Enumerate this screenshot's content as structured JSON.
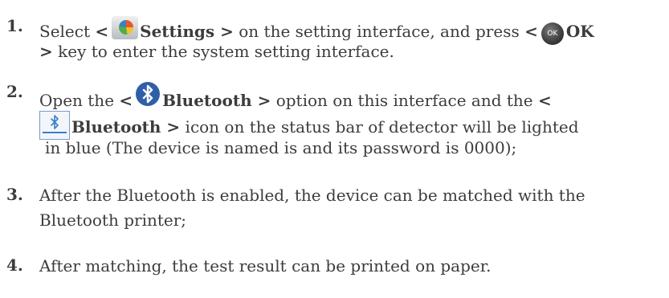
{
  "steps": [
    {
      "number": "1.",
      "line1": {
        "t1": "Select ",
        "lt": "<",
        "settings": "Settings >",
        "t2": " on the setting interface, and press ",
        "lt2": "<",
        "ok_glyph": "OK",
        "ok": "OK"
      },
      "line2": {
        "gt": ">",
        "t": " key to enter the system setting interface."
      }
    },
    {
      "number": "2.",
      "line1": {
        "t1": "Open the ",
        "lt": "<",
        "bluetooth": "Bluetooth >",
        "t2": " option on this interface and the ",
        "lt2": "<"
      },
      "line2": {
        "bluetooth": "Bluetooth >",
        "t": " icon on the status bar of  detector will be lighted"
      },
      "line3": "in blue (The device is named is  and its password is 0000);"
    },
    {
      "number": "3.",
      "line1": "After the Bluetooth is enabled, the device can be matched with the",
      "line2": "Bluetooth printer;"
    },
    {
      "number": "4.",
      "line1": "After matching, the test result can be printed on paper."
    }
  ],
  "icons": {
    "settings": "settings-icon",
    "ok_key": "ok-key-icon",
    "bluetooth": "bluetooth-icon",
    "bluetooth_status": "bluetooth-status-icon"
  },
  "colors": {
    "text": "#3c3c3c",
    "bluetooth_blue": "#2f5fa8"
  }
}
